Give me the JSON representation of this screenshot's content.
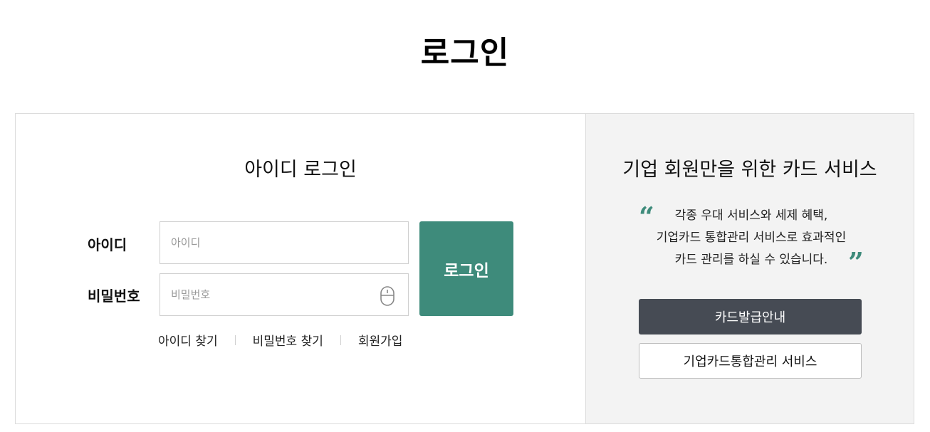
{
  "page": {
    "title": "로그인"
  },
  "login": {
    "section_title": "아이디 로그인",
    "id_label": "아이디",
    "id_placeholder": "아이디",
    "pw_label": "비밀번호",
    "pw_placeholder": "비밀번호",
    "submit_label": "로그인",
    "links": [
      {
        "label": "아이디 찾기"
      },
      {
        "label": "비밀번호 찾기"
      },
      {
        "label": "회원가입"
      }
    ],
    "keyboard_icon": "mouse-icon"
  },
  "promo": {
    "title": "기업 회원만을 위한 카드 서비스",
    "quote_open": "“",
    "quote_close": "”",
    "quote_lines": [
      "각종 우대 서비스와 세제 혜택,",
      "기업카드 통합관리 서비스로 효과적인",
      "카드 관리를 하실 수 있습니다."
    ],
    "primary_button": "카드발급안내",
    "secondary_button": "기업카드통합관리 서비스"
  },
  "colors": {
    "accent": "#3e8b7b",
    "dark_button": "#464b54",
    "right_panel_bg": "#f3f3f3"
  }
}
